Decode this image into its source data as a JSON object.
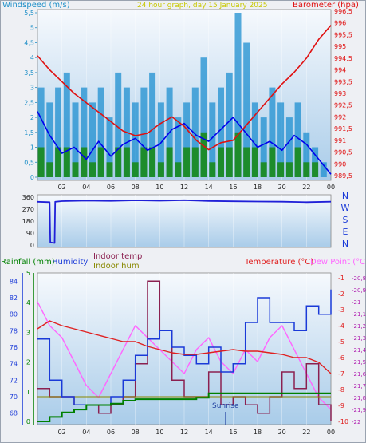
{
  "header": {
    "windspeed_label": "Windspeed (m/s)",
    "title": "24 hour graph, day 15 January 2025",
    "barometer_label": "Barometer (hpa)"
  },
  "direction_labels": [
    "N",
    "W",
    "S",
    "E",
    "N"
  ],
  "lower_header": {
    "rainfall_label": "Rainfall (mm)",
    "humidity_label": "Humidity",
    "indoor_temp_label": "Indoor temp",
    "indoor_hum_label": "Indoor hum",
    "temperature_label": "Temperature (°C)",
    "dewpoint_label": "Dew Point (°C)"
  },
  "sunrise_label": "Sunrise",
  "colors": {
    "wind_gust": "#1e8fd0",
    "wind_avg": "#1a8a1a",
    "wind_mean_line": "#0000ee",
    "barometer": "#e01010",
    "direction": "#2020d8",
    "humidity": "#1a3ad8",
    "indoor_temp": "#8b2050",
    "indoor_hum": "#888800",
    "temperature": "#e02020",
    "dewpoint": "#ff66ff",
    "rainfall": "#008000",
    "title": "#c8c800",
    "label_teal": "#2090c8",
    "sunrise": "#2040a0"
  },
  "chart_data": [
    {
      "type": "line",
      "name": "wind-barometer",
      "x_ticks": [
        "02",
        "04",
        "06",
        "08",
        "10",
        "12",
        "14",
        "16",
        "18",
        "20",
        "22",
        "00"
      ],
      "xlim": [
        0,
        24
      ],
      "y_left": {
        "label": "Windspeed (m/s)",
        "ylim": [
          0,
          5.5
        ],
        "ticks": [
          "0",
          "0,5",
          "1",
          "1,5",
          "2",
          "2,5",
          "3",
          "3,5",
          "4",
          "4,5",
          "5",
          "5,5"
        ]
      },
      "y_right": {
        "label": "Barometer (hpa)",
        "ylim": [
          989.5,
          996.5
        ],
        "ticks": [
          "989,5",
          "990",
          "990,5",
          "991",
          "991,5",
          "992",
          "992,5",
          "993",
          "993,5",
          "994",
          "994,5",
          "995",
          "995,5",
          "996",
          "996,5"
        ]
      },
      "series": [
        {
          "name": "Windspeed gust",
          "axis": "left",
          "style": "bars",
          "color": "#1e8fd0",
          "x": [
            0.3,
            1.0,
            1.7,
            2.4,
            3.1,
            3.8,
            4.5,
            5.2,
            5.9,
            6.6,
            7.3,
            8.0,
            8.7,
            9.4,
            10.1,
            10.8,
            11.5,
            12.2,
            12.9,
            13.6,
            14.3,
            15.0,
            15.7,
            16.4,
            17.1,
            17.8,
            18.5,
            19.2,
            19.9,
            20.6,
            21.3,
            22.0,
            22.7,
            23.4
          ],
          "y": [
            3.0,
            2.5,
            3.0,
            3.5,
            2.5,
            3.0,
            2.5,
            3.0,
            2.0,
            3.5,
            3.0,
            2.5,
            3.0,
            3.5,
            2.5,
            3.0,
            2.0,
            2.5,
            3.0,
            4.0,
            2.5,
            3.0,
            3.5,
            5.5,
            4.5,
            2.5,
            2.0,
            3.0,
            2.5,
            2.0,
            2.5,
            1.5,
            1.0,
            0.5
          ]
        },
        {
          "name": "Windspeed avg",
          "axis": "left",
          "style": "bars",
          "color": "#1a8a1a",
          "x": [
            0.3,
            1.0,
            1.7,
            2.4,
            3.1,
            3.8,
            4.5,
            5.2,
            5.9,
            6.6,
            7.3,
            8.0,
            8.7,
            9.4,
            10.1,
            10.8,
            11.5,
            12.2,
            12.9,
            13.6,
            14.3,
            15.0,
            15.7,
            16.4,
            17.1,
            17.8,
            18.5,
            19.2,
            19.9,
            20.6,
            21.3,
            22.0,
            22.7,
            23.4
          ],
          "y": [
            1.0,
            0.5,
            1.0,
            1.0,
            0.5,
            1.0,
            0.5,
            1.0,
            0.5,
            1.0,
            1.0,
            0.5,
            1.0,
            1.0,
            0.5,
            1.0,
            0.5,
            1.0,
            1.0,
            1.5,
            0.5,
            1.0,
            1.0,
            1.5,
            1.0,
            1.0,
            0.5,
            1.0,
            0.5,
            0.5,
            1.0,
            0.5,
            0.5,
            0.0
          ]
        },
        {
          "name": "Windspeed mean",
          "axis": "left",
          "style": "line",
          "color": "#0000ee",
          "x": [
            0,
            1,
            2,
            3,
            4,
            5,
            6,
            7,
            8,
            9,
            10,
            11,
            12,
            13,
            14,
            15,
            16,
            17,
            18,
            19,
            20,
            21,
            22,
            23,
            24
          ],
          "y": [
            2.2,
            1.4,
            0.8,
            1.0,
            0.6,
            1.2,
            0.7,
            1.1,
            1.3,
            0.9,
            1.1,
            1.6,
            1.8,
            1.4,
            1.2,
            1.6,
            2.0,
            1.5,
            1.0,
            1.2,
            0.9,
            1.4,
            1.1,
            0.6,
            0.1
          ]
        },
        {
          "name": "Barometer",
          "axis": "right",
          "style": "line",
          "color": "#e01010",
          "x": [
            0,
            1,
            2,
            3,
            4,
            5,
            6,
            7,
            8,
            9,
            10,
            11,
            12,
            13,
            14,
            15,
            16,
            17,
            18,
            19,
            20,
            21,
            22,
            23,
            24
          ],
          "y": [
            994.6,
            994.0,
            993.5,
            993.0,
            992.6,
            992.2,
            991.8,
            991.4,
            991.2,
            991.3,
            991.7,
            992.0,
            991.6,
            991.0,
            990.6,
            990.9,
            991.0,
            991.6,
            992.2,
            992.8,
            993.4,
            993.9,
            994.5,
            995.3,
            995.9
          ]
        }
      ]
    },
    {
      "type": "line",
      "name": "wind-direction",
      "xlim": [
        0,
        24
      ],
      "ylim": [
        0,
        360
      ],
      "y_ticks": [
        "0",
        "90",
        "180",
        "270",
        "360"
      ],
      "series": [
        {
          "name": "Wind direction",
          "color": "#2020d8",
          "x": [
            0,
            1.0,
            1.05,
            1.4,
            1.45,
            2,
            4,
            6,
            8,
            10,
            12,
            14,
            16,
            18,
            20,
            22,
            24
          ],
          "y": [
            325,
            322,
            20,
            15,
            325,
            330,
            334,
            332,
            336,
            333,
            337,
            331,
            329,
            327,
            326,
            322,
            326
          ]
        }
      ]
    },
    {
      "type": "line",
      "name": "temperature-humidity",
      "xlim": [
        0,
        24
      ],
      "y_humidity": {
        "ylim": [
          67,
          85
        ],
        "ticks": [
          "68",
          "70",
          "72",
          "74",
          "76",
          "78",
          "80",
          "82",
          "84"
        ]
      },
      "y_rain": {
        "ylim": [
          0,
          5
        ],
        "ticks": [
          "0",
          "1",
          "2",
          "3",
          "4",
          "5"
        ]
      },
      "y_temp": {
        "ylim": [
          -10,
          -1
        ],
        "ticks": [
          "-10",
          "-9",
          "-8",
          "-7",
          "-6",
          "-5",
          "-4",
          "-3",
          "-2",
          "-1"
        ]
      },
      "y_dew": {
        "ylim": [
          -22.0,
          -20.8
        ],
        "ticks": [
          "-22",
          "-21,9",
          "-21,8",
          "-21,7",
          "-21,6",
          "-21,5",
          "-21,4",
          "-21,3",
          "-21,2",
          "-21,1",
          "-21",
          "-20,9",
          "-20,8"
        ]
      },
      "series": [
        {
          "name": "Humidity",
          "axis": "humidity",
          "color": "#1a3ad8",
          "x": [
            0,
            1,
            2,
            3,
            4,
            5,
            6,
            7,
            8,
            9,
            10,
            11,
            12,
            13,
            14,
            15,
            16,
            17,
            18,
            19,
            20,
            21,
            22,
            23,
            24
          ],
          "y": [
            77,
            72,
            70,
            69,
            69,
            69,
            70,
            72,
            75,
            77,
            78,
            76,
            75,
            74,
            76,
            73,
            74,
            79,
            82,
            79,
            79,
            78,
            81,
            80,
            83
          ]
        },
        {
          "name": "Indoor temp",
          "axis": "humidity",
          "color": "#8b2050",
          "x": [
            0,
            1,
            2,
            3,
            4,
            5,
            6,
            7,
            8,
            9,
            10,
            11,
            12,
            13,
            14,
            15,
            16,
            17,
            18,
            19,
            20,
            21,
            22,
            23,
            24
          ],
          "y": [
            71,
            70,
            70,
            69,
            69,
            68,
            69,
            70,
            74,
            84,
            78,
            72,
            70,
            70,
            73,
            69,
            70,
            69,
            68,
            70,
            73,
            71,
            74,
            69,
            67
          ]
        },
        {
          "name": "Indoor hum",
          "axis": "humidity",
          "color": "#888800",
          "x": [
            0,
            24
          ],
          "y": [
            70,
            70
          ]
        },
        {
          "name": "Temperature",
          "axis": "temp",
          "color": "#e02020",
          "x": [
            0,
            1,
            2,
            3,
            4,
            5,
            6,
            7,
            8,
            9,
            10,
            11,
            12,
            13,
            14,
            15,
            16,
            17,
            18,
            19,
            20,
            21,
            22,
            23,
            24
          ],
          "y": [
            -4.2,
            -3.7,
            -4.0,
            -4.2,
            -4.4,
            -4.6,
            -4.8,
            -5.0,
            -5.0,
            -5.3,
            -5.5,
            -5.7,
            -5.8,
            -5.8,
            -5.7,
            -5.6,
            -5.5,
            -5.6,
            -5.6,
            -5.7,
            -5.8,
            -6.0,
            -6.0,
            -6.3,
            -7.0
          ]
        },
        {
          "name": "Dew Point",
          "axis": "dew",
          "color": "#ff66ff",
          "x": [
            0,
            1,
            2,
            3,
            4,
            5,
            6,
            7,
            8,
            9,
            10,
            11,
            12,
            13,
            14,
            15,
            16,
            17,
            18,
            19,
            20,
            21,
            22,
            23,
            24
          ],
          "y": [
            -21.0,
            -21.2,
            -21.3,
            -21.5,
            -21.7,
            -21.8,
            -21.6,
            -21.4,
            -21.2,
            -21.3,
            -21.4,
            -21.5,
            -21.6,
            -21.4,
            -21.3,
            -21.5,
            -21.6,
            -21.4,
            -21.5,
            -21.3,
            -21.2,
            -21.4,
            -21.6,
            -21.8,
            -21.9
          ]
        },
        {
          "name": "Rainfall",
          "axis": "rain",
          "color": "#008000",
          "x": [
            0,
            1,
            2,
            3,
            4,
            5,
            6,
            7,
            8,
            9,
            10,
            11,
            12,
            13,
            14,
            15,
            16,
            17,
            18,
            19,
            20,
            21,
            22,
            23,
            24
          ],
          "y": [
            0,
            0.15,
            0.3,
            0.4,
            0.55,
            0.55,
            0.6,
            0.7,
            0.75,
            0.75,
            0.75,
            0.75,
            0.75,
            0.8,
            0.95,
            0.95,
            0.95,
            0.95,
            0.95,
            0.95,
            0.95,
            0.95,
            0.95,
            0.95,
            0.95
          ]
        }
      ]
    }
  ]
}
